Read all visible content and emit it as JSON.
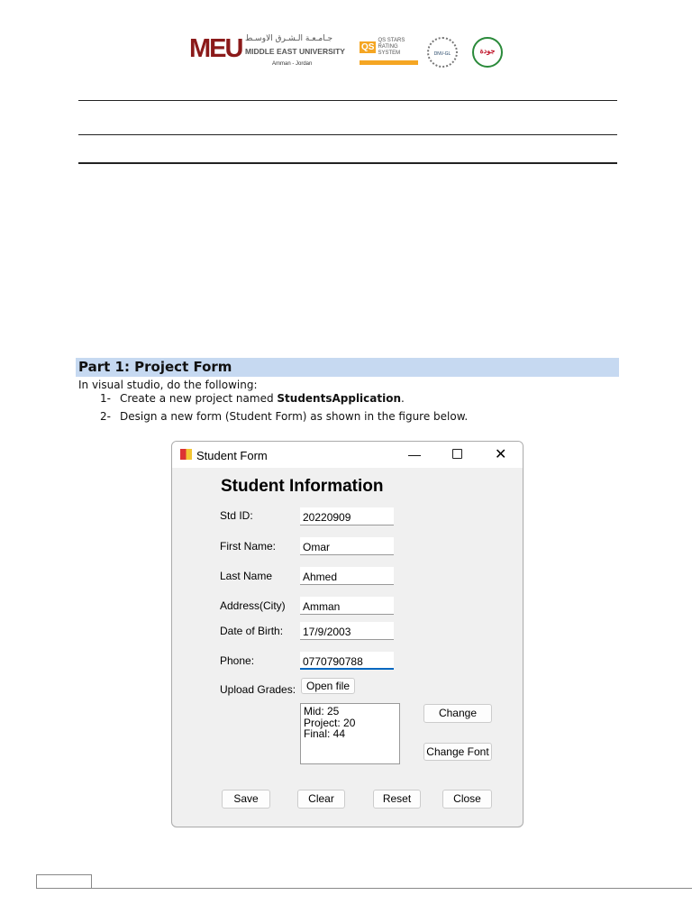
{
  "header": {
    "logo_text": "MEU",
    "university_ar": "جـامـعـة الـشـرق الاوسـط",
    "university_en": "MIDDLE EAST UNIVERSITY",
    "location": "Amman - Jordan",
    "qs_logo": "QS STARS RATING SYSTEM",
    "dnv_logo": "DNV-GL",
    "quality_logo": "جودة"
  },
  "section": {
    "heading": "Part 1: Project Form",
    "intro": "In visual studio, do the following:",
    "steps": [
      {
        "num": "1-",
        "text": "Create a new project named ",
        "bold": "StudentsApplication",
        "tail": "."
      },
      {
        "num": "2-",
        "text": "Design a new form (Student Form) as shown in the figure below."
      }
    ]
  },
  "form": {
    "title": "Student Form",
    "heading": "Student Information",
    "fields": [
      {
        "label": "Std ID:",
        "value": "20220909"
      },
      {
        "label": "First Name:",
        "value": "Omar"
      },
      {
        "label": "Last Name",
        "value": "Ahmed"
      },
      {
        "label": "Address(City)",
        "value": "Amman"
      },
      {
        "label": "Date of Birth:",
        "value": "17/9/2003"
      },
      {
        "label": "Phone:",
        "value": "0770790788"
      }
    ],
    "upload_label": "Upload Grades:",
    "open_file": "Open file",
    "grades": [
      "Mid: 25",
      "Project: 20",
      "Final: 44"
    ],
    "change": "Change",
    "change_font": "Change Font",
    "buttons": [
      "Save",
      "Clear",
      "Reset",
      "Close"
    ]
  }
}
